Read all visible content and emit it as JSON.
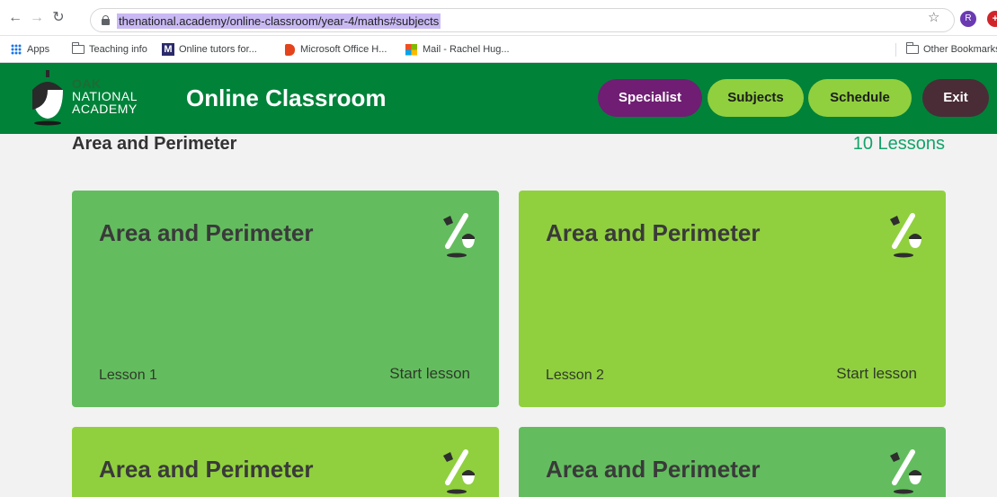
{
  "browser": {
    "url": "thenational.academy/online-classroom/year-4/maths#subjects",
    "profile_initial": "R",
    "bookmarks": [
      {
        "label": "Apps",
        "icon": "apps-grid-icon"
      },
      {
        "label": "Teaching info",
        "icon": "folder-icon"
      },
      {
        "label": "Online tutors for...",
        "icon": "m-logo-icon"
      },
      {
        "label": "Microsoft Office H...",
        "icon": "office-logo-icon"
      },
      {
        "label": "Mail - Rachel Hug...",
        "icon": "microsoft-logo-icon"
      }
    ],
    "other_bookmarks": "Other Bookmarks"
  },
  "header": {
    "logo_line1": "OAK",
    "logo_line2": "NATIONAL",
    "logo_line3": "ACADEMY",
    "title": "Online Classroom",
    "nav": {
      "specialist": "Specialist",
      "subjects": "Subjects",
      "schedule": "Schedule",
      "exit": "Exit"
    }
  },
  "unit": {
    "title": "Area and Perimeter",
    "lesson_count": "10 Lessons"
  },
  "lessons": [
    {
      "title": "Area and Perimeter",
      "lesson": "Lesson 1",
      "action": "Start lesson",
      "color": "#63bd5e"
    },
    {
      "title": "Area and Perimeter",
      "lesson": "Lesson 2",
      "action": "Start lesson",
      "color": "#90d03e"
    },
    {
      "title": "Area and Perimeter",
      "lesson": "",
      "action": "",
      "color": "#90d03e"
    },
    {
      "title": "Area and Perimeter",
      "lesson": "",
      "action": "",
      "color": "#63bd5e"
    }
  ],
  "colors": {
    "header_green": "#008239",
    "specialist_purple": "#6f1e73",
    "pill_green": "#90d03e",
    "exit_dark": "#4a2c36",
    "count_green": "#14a26a"
  }
}
